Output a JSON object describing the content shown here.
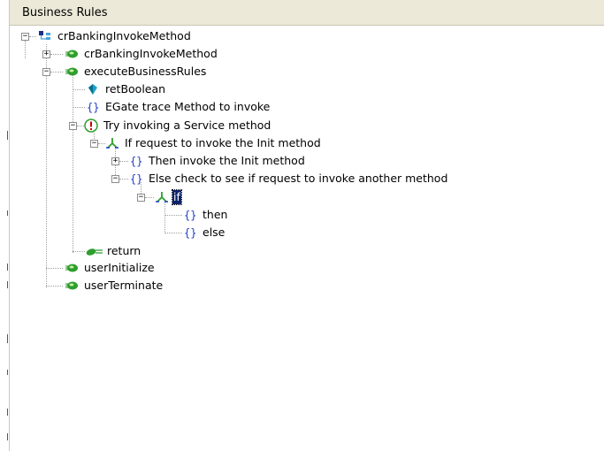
{
  "panel": {
    "title": "Business Rules"
  },
  "tree": {
    "root": "crBankingInvokeMethod",
    "method_1": "crBankingInvokeMethod",
    "execute": "executeBusinessRules",
    "ret_boolean": "retBoolean",
    "egate_trace": "EGate trace Method to invoke",
    "try_block": "Try invoking a Service method",
    "if_init": "If request to invoke the Init method",
    "then_init": "Then invoke the Init method",
    "else_check": "Else check to see if request to invoke another method",
    "if_nested": "if",
    "then": "then",
    "else": "else",
    "return": "return",
    "user_initialize": "userInitialize",
    "user_terminate": "userTerminate"
  },
  "icons": {
    "root": "class-icon",
    "method": "method-icon",
    "variable": "variable-icon",
    "block": "braces-icon",
    "try": "exclamation-icon",
    "branch": "branch-icon",
    "return": "return-icon"
  },
  "colors": {
    "selection": "#0a246a",
    "method_green": "#2e9e2e",
    "braces_blue": "#1f3cc8",
    "title_bar": "#ece9d8"
  }
}
